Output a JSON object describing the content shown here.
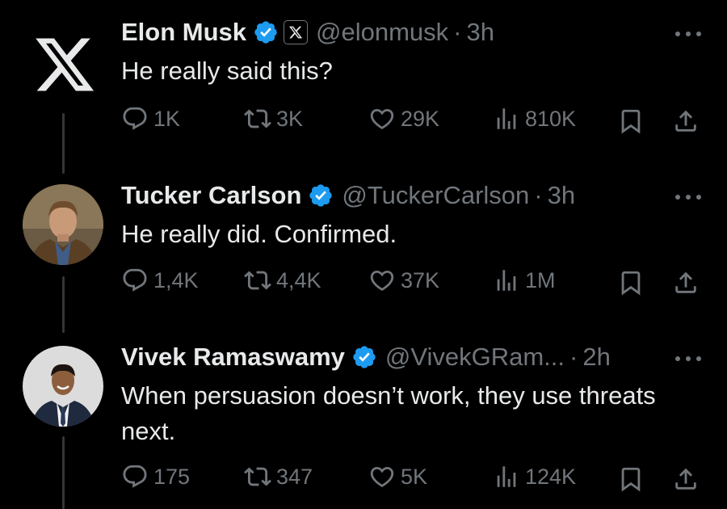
{
  "tweets": [
    {
      "author": {
        "name": "Elon Musk",
        "handle": "@elonmusk",
        "avatar_icon": "x-logo-icon",
        "affiliate_badge_icon": "x-affiliate-badge-icon"
      },
      "time": "3h",
      "separator": "·",
      "text": "He really said this?",
      "stats": {
        "replies": "1K",
        "reposts": "3K",
        "likes": "29K",
        "views": "810K"
      }
    },
    {
      "author": {
        "name": "Tucker Carlson",
        "handle": "@TuckerCarlson",
        "avatar_icon": "avatar-photo"
      },
      "time": "3h",
      "separator": "·",
      "text": "He really did. Confirmed.",
      "stats": {
        "replies": "1,4K",
        "reposts": "4,4K",
        "likes": "37K",
        "views": "1M"
      }
    },
    {
      "author": {
        "name": "Vivek Ramaswamy",
        "handle": "@VivekGRam...",
        "avatar_icon": "avatar-photo"
      },
      "time": "2h",
      "separator": "·",
      "text": "When persuasion doesn’t work, they use threats next.",
      "stats": {
        "replies": "175",
        "reposts": "347",
        "likes": "5K",
        "views": "124K"
      }
    }
  ],
  "colors": {
    "background": "#000000",
    "text": "#e7e9ea",
    "muted": "#71767b",
    "verified": "#1d9bf0",
    "thread_line": "#333639"
  },
  "icons": [
    "reply-icon",
    "repost-icon",
    "like-icon",
    "views-icon",
    "bookmark-icon",
    "share-icon",
    "more-icon",
    "verified-icon"
  ]
}
